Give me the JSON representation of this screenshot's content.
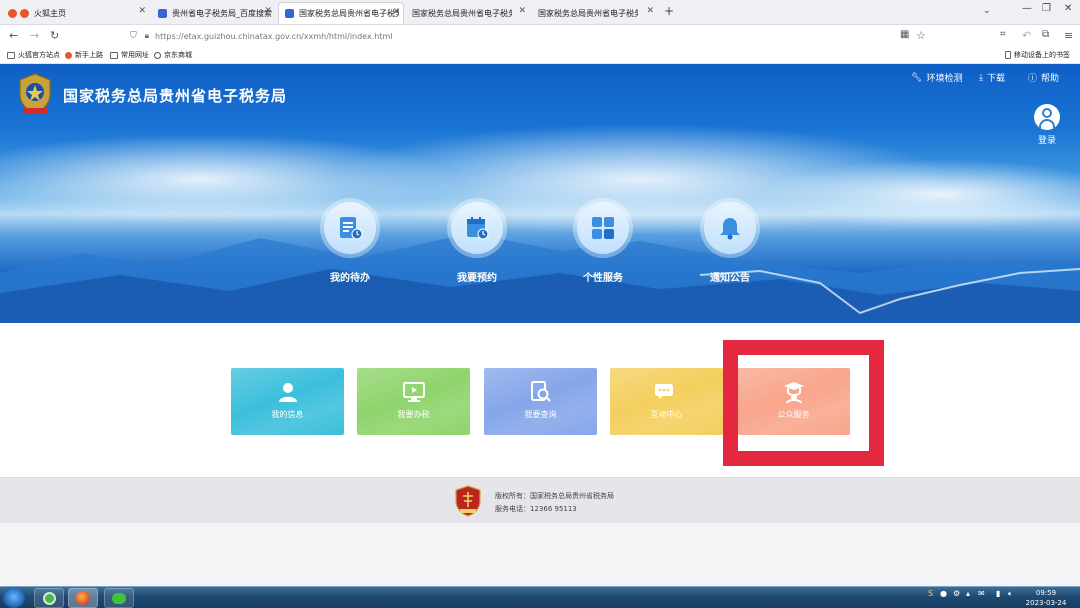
{
  "browser": {
    "tabs": [
      {
        "label": "火狐主页",
        "favicon_color": "#e6572b",
        "active": false
      },
      {
        "label": "贵州省电子税务局_百度搜索",
        "favicon_color": "#3a62d8",
        "active": false
      },
      {
        "label": "国家税务总局贵州省电子税务局",
        "favicon_color": "#3a62d8",
        "active": true
      },
      {
        "label": "国家税务总局贵州省电子税务局",
        "favicon_color": "",
        "active": false
      },
      {
        "label": "国家税务总局贵州省电子税务局",
        "favicon_color": "",
        "active": false
      }
    ],
    "url": "https://etax.guizhou.chinatax.gov.cn/xxmh/html/index.html",
    "bookmarks": [
      "火狐官方站点",
      "新手上路",
      "常用网址",
      "京东商城"
    ],
    "mobile_bookmarks": "移动设备上的书签"
  },
  "site": {
    "title": "国家税务总局贵州省电子税务局",
    "top_links": {
      "env_check": "环境检测",
      "download": "下载",
      "help": "帮助"
    },
    "login": "登录",
    "hero_items": [
      "我的待办",
      "我要预约",
      "个性服务",
      "通知公告"
    ],
    "cards": [
      {
        "label": "我的信息",
        "color": "#3cbfdc",
        "icon": "user-icon"
      },
      {
        "label": "我要办税",
        "color": "#8fd46c",
        "icon": "monitor-icon"
      },
      {
        "label": "我要查询",
        "color": "#86a6ea",
        "icon": "search-doc-icon"
      },
      {
        "label": "互动中心",
        "color": "#f4cf5e",
        "icon": "chat-icon"
      },
      {
        "label": "公众服务",
        "color": "#f9a58c",
        "icon": "graduate-icon"
      }
    ],
    "highlight_color": "#e3283f",
    "footer": {
      "copyright": "版权所有：国家税务总局贵州省税务局",
      "phone": "服务电话：12366    95113"
    }
  },
  "taskbar": {
    "time": "09:59",
    "date": "2023-03-24"
  }
}
